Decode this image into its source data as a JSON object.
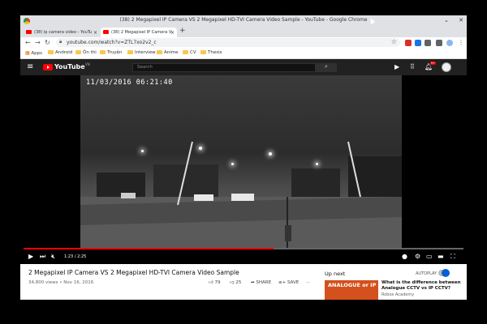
{
  "window": {
    "title": "(38) 2 Megapixel IP Camera VS 2 Megapixel HD-TVI Camera Video Sample - YouTube - Google Chrome"
  },
  "tabs": [
    {
      "label": "(38) ip camera video - YouTu"
    },
    {
      "label": "(38) 2 Megapixel IP Camera V"
    }
  ],
  "toolbar": {
    "url": "youtube.com/watch?v=ZTL7xo2v2_c"
  },
  "bookmarks": [
    {
      "label": "Apps"
    },
    {
      "label": "Android"
    },
    {
      "label": "Ôn thi"
    },
    {
      "label": "Truyện"
    },
    {
      "label": "Interview"
    },
    {
      "label": "Anime"
    },
    {
      "label": "CV"
    },
    {
      "label": "Thesis"
    }
  ],
  "youtube": {
    "logo_text": "YouTube",
    "region": "VN",
    "search_placeholder": "Search",
    "notification_count": "9+"
  },
  "player": {
    "timestamp_overlay": "11/03/2016 06:21:40",
    "time_display": "1:23 / 2:25",
    "progress": 0.568
  },
  "video": {
    "title": "2 Megapixel IP Camera VS 2 Megapixel HD-TVI Camera Video Sample",
    "meta": "34,800 views • Nov 16, 2016",
    "likes": "79",
    "dislikes": "25",
    "share_label": "SHARE",
    "save_label": "SAVE"
  },
  "sidebar": {
    "up_next_label": "Up next",
    "autoplay_label": "AUTOPLAY",
    "next": {
      "thumb_text": "ANALOGUE or IP",
      "title": "What is the difference between Analogue CCTV vs IP CCTV?",
      "channel": "Robox Academy"
    }
  },
  "colors": {
    "youtube_red": "#ff0000",
    "header_bg": "#212121",
    "autoplay_blue": "#065fd4"
  }
}
